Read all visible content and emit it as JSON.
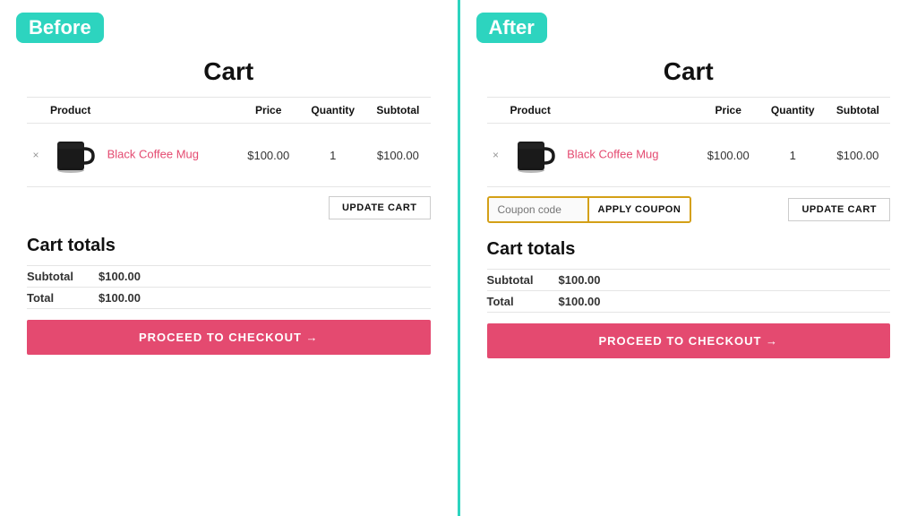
{
  "before": {
    "badge": "Before",
    "cart_title": "Cart",
    "table": {
      "headers": [
        "",
        "Product",
        "Price",
        "Quantity",
        "Subtotal"
      ],
      "row": {
        "remove": "×",
        "product_name": "Black Coffee Mug",
        "price": "$100.00",
        "quantity": "1",
        "subtotal": "$100.00"
      }
    },
    "update_cart_label": "UPDATE CART",
    "cart_totals_title": "Cart totals",
    "subtotal_label": "Subtotal",
    "subtotal_value": "$100.00",
    "total_label": "Total",
    "total_value": "$100.00",
    "checkout_label": "PROCEED TO CHECKOUT →"
  },
  "after": {
    "badge": "After",
    "cart_title": "Cart",
    "table": {
      "headers": [
        "",
        "Product",
        "Price",
        "Quantity",
        "Subtotal"
      ],
      "row": {
        "remove": "×",
        "product_name": "Black Coffee Mug",
        "price": "$100.00",
        "quantity": "1",
        "subtotal": "$100.00"
      }
    },
    "coupon_placeholder": "Coupon code",
    "apply_coupon_label": "APPLY COUPON",
    "update_cart_label": "UPDATE CART",
    "cart_totals_title": "Cart totals",
    "subtotal_label": "Subtotal",
    "subtotal_value": "$100.00",
    "total_label": "Total",
    "total_value": "$100.00",
    "checkout_label": "PROCEED TO CHECKOUT →"
  },
  "colors": {
    "teal": "#2dd4bf",
    "red": "#e44a70",
    "gold": "#d4a017"
  }
}
